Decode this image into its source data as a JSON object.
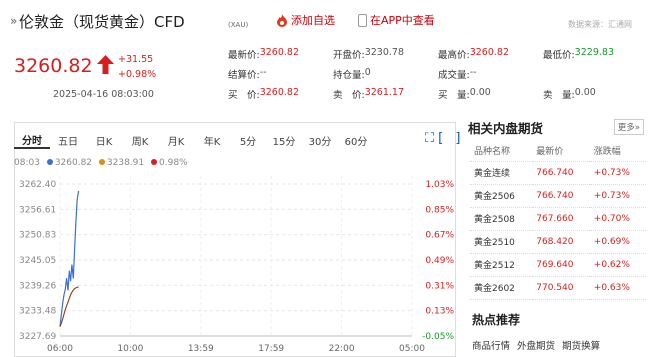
{
  "header": {
    "title": "伦敦金（现货黄金）CFD",
    "code": "(XAU)",
    "add_watch": "添加自选",
    "open_app": "在APP中查看",
    "source": "数据来源：汇通网"
  },
  "quote": {
    "price": "3260.82",
    "change": "+31.55",
    "change_pct": "+0.98%",
    "datetime": "2025-04-16 08:03:00",
    "up_color": "#d61e1e"
  },
  "stats": {
    "rows": [
      [
        {
          "label": "最新价:",
          "value": "3260.82"
        },
        {
          "label": "开盘价:",
          "value": "3230.78"
        },
        {
          "label": "最高价:",
          "value": "3260.82"
        },
        {
          "label": "最低价:",
          "value": "3229.83"
        }
      ],
      [
        {
          "label": "结算价:",
          "value": "--"
        },
        {
          "label": "持仓量:",
          "value": "0"
        },
        {
          "label": "成交量:",
          "value": "--"
        },
        {
          "label": "",
          "value": ""
        }
      ],
      [
        {
          "label": "买　价:",
          "value": "3260.82"
        },
        {
          "label": "卖　价:",
          "value": "3261.17"
        },
        {
          "label": "买　量:",
          "value": "0.00"
        },
        {
          "label": "卖　量:",
          "value": "0.00"
        }
      ]
    ]
  },
  "tabs": [
    "分时",
    "五日",
    "日K",
    "周K",
    "月K",
    "年K",
    "5分",
    "15分",
    "30分",
    "60分"
  ],
  "legend": {
    "time": "08:03",
    "price": "3260.82",
    "avg": "3238.91",
    "pct": "0.98%"
  },
  "chart_data": {
    "type": "line",
    "y_ticks": [
      "3262.40",
      "3256.61",
      "3250.83",
      "3245.05",
      "3239.26",
      "3233.48",
      "3227.69"
    ],
    "pct_ticks": [
      "1.03%",
      "0.85%",
      "0.67%",
      "0.49%",
      "0.31%",
      "0.13%",
      "-0.05%"
    ],
    "x_ticks": [
      "06:00",
      "10:00",
      "13:59",
      "17:59",
      "22:00",
      "05:00"
    ],
    "ylim": [
      3227.69,
      3262.4
    ],
    "grid": true,
    "series": [
      {
        "values": [
          3229.83,
          3232.5,
          3235.2,
          3237.1,
          3238.4,
          3240.9,
          3238.1,
          3242.6,
          3240.2,
          3244.0,
          3240.8,
          3247.5,
          3253.8,
          3258.9,
          3260.82
        ]
      },
      {
        "values": [
          3229.83,
          3230.6,
          3231.6,
          3232.7,
          3233.7,
          3234.6,
          3235.4,
          3236.3,
          3237.1,
          3237.7,
          3238.2,
          3238.5,
          3238.7,
          3238.8,
          3238.91
        ]
      }
    ]
  },
  "sidebar": {
    "title": "相关内盘期货",
    "more": "更多»",
    "headers": [
      "品种名称",
      "最新价",
      "涨跌幅"
    ],
    "rows": [
      [
        "黄金连续",
        "766.740",
        "+0.73%"
      ],
      [
        "黄金2506",
        "766.740",
        "+0.73%"
      ],
      [
        "黄金2508",
        "767.660",
        "+0.70%"
      ],
      [
        "黄金2510",
        "768.420",
        "+0.69%"
      ],
      [
        "黄金2512",
        "769.640",
        "+0.62%"
      ],
      [
        "黄金2602",
        "770.540",
        "+0.63%"
      ]
    ],
    "hot_title": "热点推荐",
    "hot_links": [
      "商品行情",
      "外盘期货",
      "期货换算"
    ]
  },
  "icons": {
    "title": "angle-quote-icon",
    "add_watch": "fire-icon",
    "open_app": "phone-icon",
    "up": "up-arrow-icon",
    "ctrl": [
      "expand-icon",
      "bracket-icon"
    ]
  }
}
